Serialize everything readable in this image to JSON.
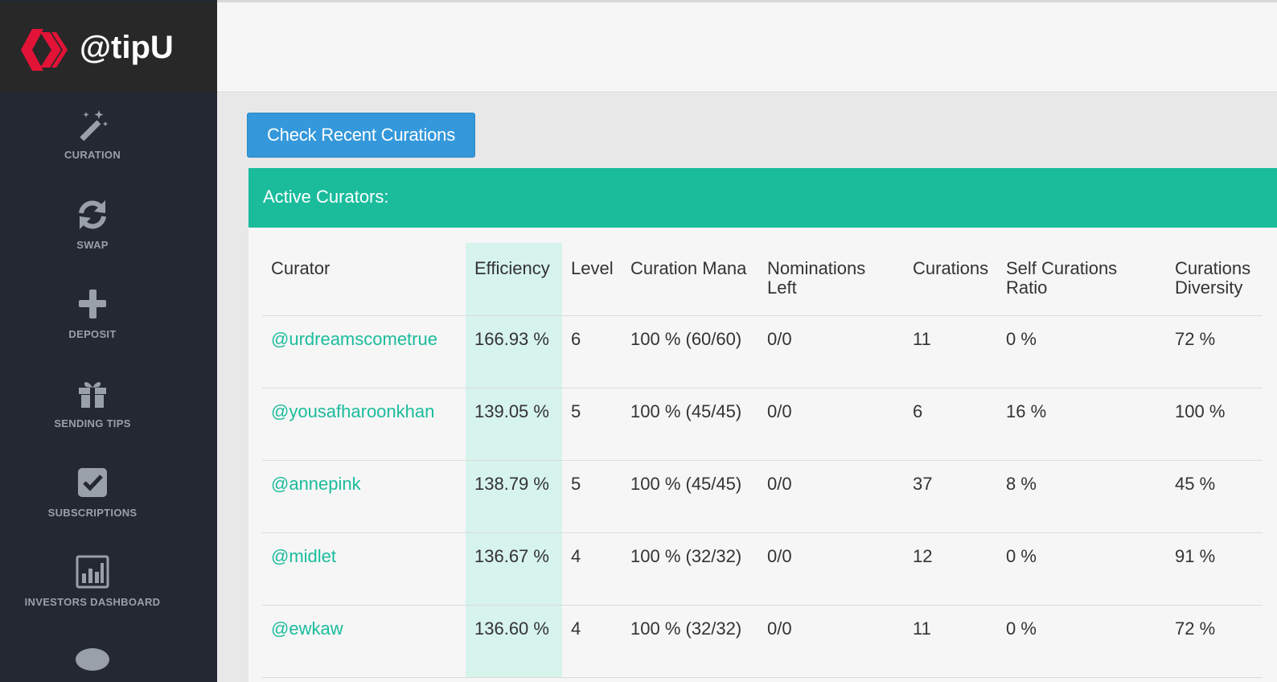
{
  "brand": {
    "name": "@tipU",
    "logo_color": "#e31337"
  },
  "nav": {
    "items": [
      {
        "label": "CURATION",
        "icon": "magic-wand-icon"
      },
      {
        "label": "SWAP",
        "icon": "refresh-icon"
      },
      {
        "label": "DEPOSIT",
        "icon": "plus-icon"
      },
      {
        "label": "SENDING TIPS",
        "icon": "gift-icon"
      },
      {
        "label": "SUBSCRIPTIONS",
        "icon": "checkbox-icon"
      },
      {
        "label": "INVESTORS DASHBOARD",
        "icon": "bar-chart-icon"
      }
    ]
  },
  "main": {
    "check_button_label": "Check Recent Curations",
    "panel_title": "Active Curators:",
    "accent_color": "#1abc9c",
    "button_color": "#3498db",
    "table": {
      "headers": [
        "Curator",
        "Efficiency",
        "Level",
        "Curation Mana",
        "Nominations Left",
        "Curations",
        "Self Curations Ratio",
        "Curations Diversity"
      ],
      "rows": [
        {
          "curator": "@urdreamscometrue",
          "efficiency": "166.93 %",
          "level": "6",
          "mana": "100 % (60/60)",
          "nominations": "0/0",
          "curations": "11",
          "self_ratio": "0 %",
          "diversity": "72 %"
        },
        {
          "curator": "@yousafharoonkhan",
          "efficiency": "139.05 %",
          "level": "5",
          "mana": "100 % (45/45)",
          "nominations": "0/0",
          "curations": "6",
          "self_ratio": "16 %",
          "diversity": "100 %"
        },
        {
          "curator": "@annepink",
          "efficiency": "138.79 %",
          "level": "5",
          "mana": "100 % (45/45)",
          "nominations": "0/0",
          "curations": "37",
          "self_ratio": "8 %",
          "diversity": "45 %"
        },
        {
          "curator": "@midlet",
          "efficiency": "136.67 %",
          "level": "4",
          "mana": "100 % (32/32)",
          "nominations": "0/0",
          "curations": "12",
          "self_ratio": "0 %",
          "diversity": "91 %"
        },
        {
          "curator": "@ewkaw",
          "efficiency": "136.60 %",
          "level": "4",
          "mana": "100 % (32/32)",
          "nominations": "0/0",
          "curations": "11",
          "self_ratio": "0 %",
          "diversity": "72 %"
        }
      ]
    }
  }
}
